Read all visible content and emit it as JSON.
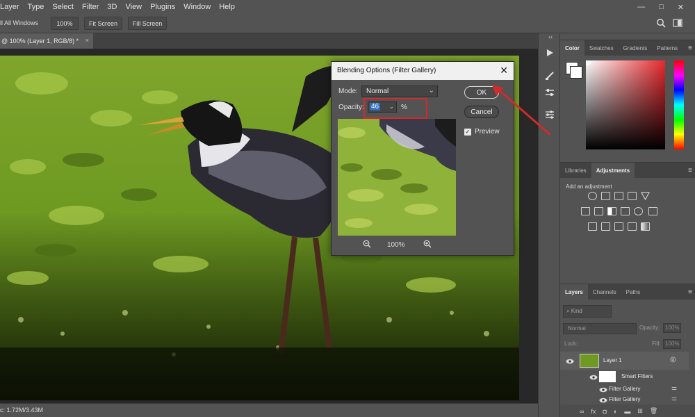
{
  "menubar": {
    "items": [
      "Layer",
      "Type",
      "Select",
      "Filter",
      "3D",
      "View",
      "Plugins",
      "Window",
      "Help"
    ],
    "window_controls": [
      "—",
      "□",
      "✕"
    ]
  },
  "options_bar": {
    "scroll_all_windows": "ll All Windows",
    "zoom_100": "100%",
    "fit_screen": "Fit Screen",
    "fill_screen": "Fill Screen"
  },
  "document": {
    "tab_title": "@ 100% (Layer 1, RGB/8) *",
    "tab_close": "×",
    "status": "c: 1.72M/3.43M"
  },
  "tool_strip": {
    "collapse": "‹‹",
    "icons": [
      "play-icon",
      "brush-settings-icon",
      "properties-icon",
      "adjustments-sliders-icon"
    ]
  },
  "color_panel": {
    "tabs": [
      "Color",
      "Swatches",
      "Gradients",
      "Patterns"
    ],
    "foreground": "#ffffff",
    "background": "#ffffff",
    "hue_color": "#e8282d"
  },
  "adjustments_panel": {
    "tabs": [
      "Libraries",
      "Adjustments"
    ],
    "add_label": "Add an adjustment"
  },
  "layers_panel": {
    "tabs": [
      "Layers",
      "Channels",
      "Paths"
    ],
    "kind": "Kind",
    "blend_mode": "Normal",
    "opacity_label": "Opacity:",
    "opacity_value": "100%",
    "lock_label": "Lock:",
    "fill_label": "Fill:",
    "fill_value": "100%",
    "layers": [
      {
        "name": "Layer 1"
      },
      {
        "name": "Smart Filters"
      },
      {
        "name": "Filter Gallery"
      },
      {
        "name": "Filter Gallery"
      }
    ]
  },
  "dialog": {
    "title": "Blending Options (Filter Gallery)",
    "close": "✕",
    "mode_label": "Mode:",
    "mode_value": "Normal",
    "opacity_label": "Opacity:",
    "opacity_value": "46",
    "opacity_unit": "%",
    "ok": "OK",
    "cancel": "Cancel",
    "preview_label": "Preview",
    "preview_checked": "✓",
    "zoom": "100%"
  },
  "annotation": {
    "color": "#d12b2b"
  }
}
